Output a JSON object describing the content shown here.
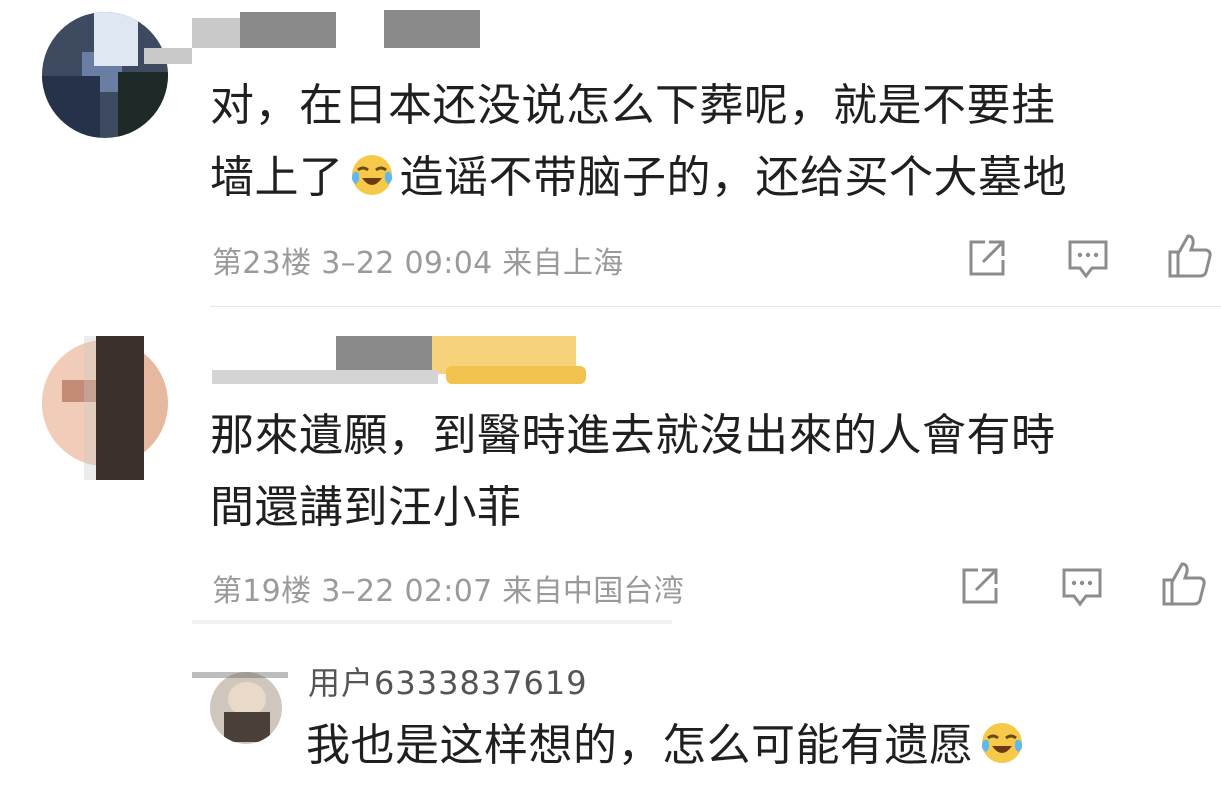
{
  "comments": [
    {
      "text_line1": "对，在日本还没说怎么下葬呢，就是不要挂",
      "text_line2a": "墙上了",
      "text_line2b": "造谣不带脑子的，还给买个大墓地",
      "emoji": "laughing-crying-emoji",
      "meta": "第23楼 3–22 09:04 来自上海"
    },
    {
      "text_line1": "那來遺願，到醫時進去就沒出來的人會有時",
      "text_line2": "間還講到汪小菲",
      "meta": "第19楼 3–22 02:07 来自中国台湾"
    },
    {
      "username": "用户6333837619",
      "text_line1": "我也是这样想的，怎么可能有遗愿",
      "emoji": "laughing-crying-emoji"
    }
  ],
  "icons": {
    "share": "share-icon",
    "reply": "comment-icon",
    "like": "thumbs-up-icon"
  },
  "colors": {
    "text": "#1f1f1f",
    "meta": "#9a9a9a",
    "icon": "#8c8c8c",
    "divider": "#e6e6e6"
  }
}
